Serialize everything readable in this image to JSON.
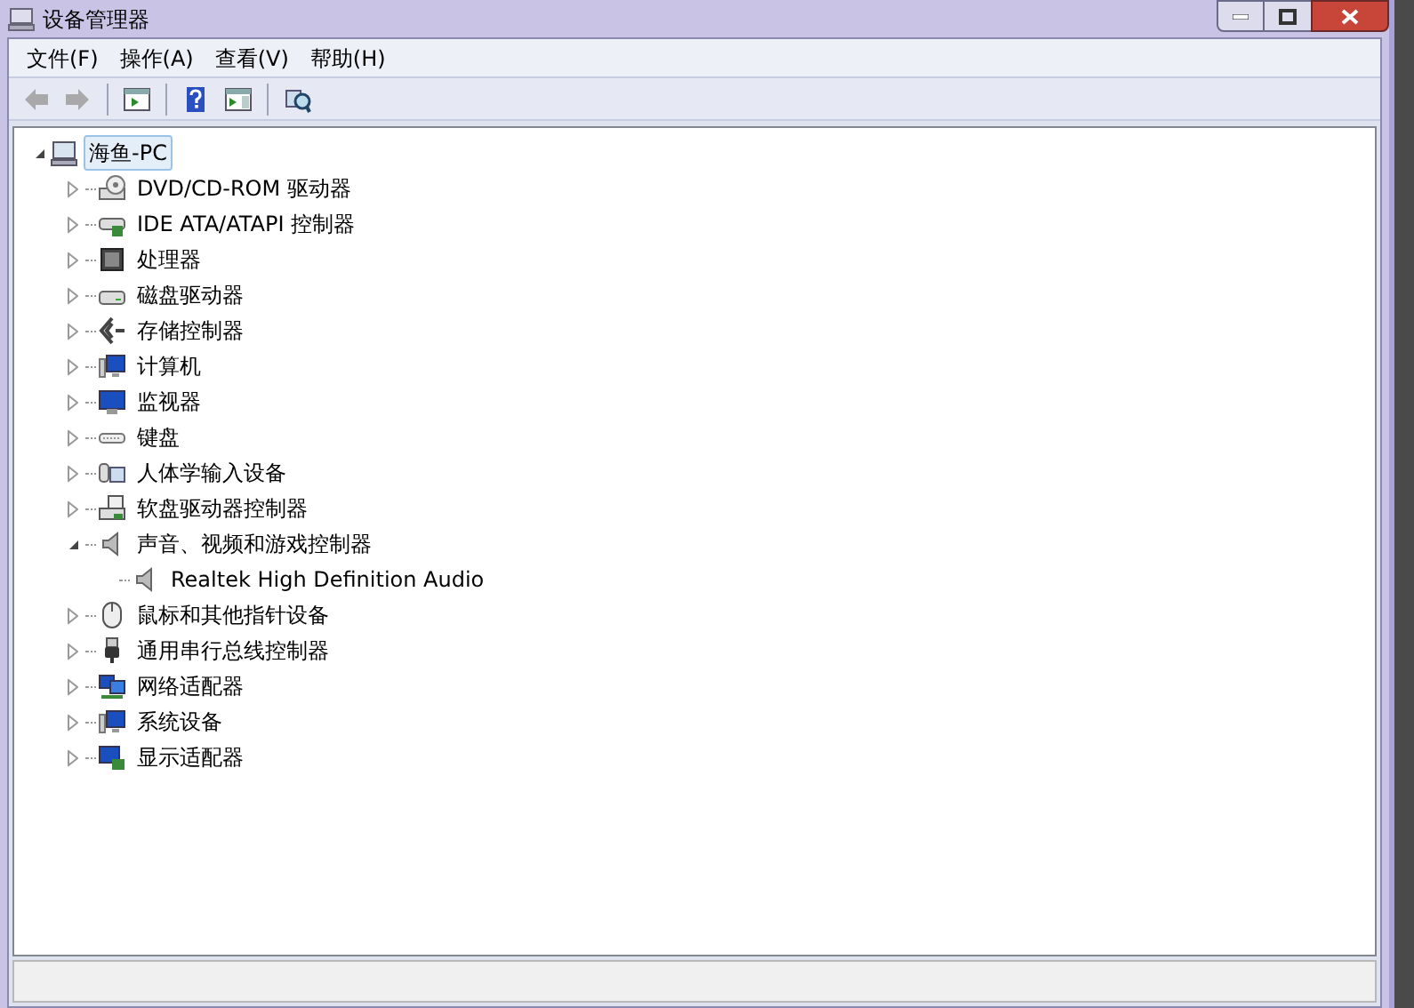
{
  "window": {
    "title": "设备管理器"
  },
  "menu": [
    {
      "label": "文件(F)"
    },
    {
      "label": "操作(A)"
    },
    {
      "label": "查看(V)"
    },
    {
      "label": "帮助(H)"
    }
  ],
  "toolbar": [
    {
      "kind": "back",
      "disabled": true
    },
    {
      "kind": "forward",
      "disabled": true
    },
    {
      "kind": "sep"
    },
    {
      "kind": "console",
      "disabled": false
    },
    {
      "kind": "sep"
    },
    {
      "kind": "help",
      "disabled": false
    },
    {
      "kind": "pane",
      "disabled": false
    },
    {
      "kind": "sep"
    },
    {
      "kind": "scan",
      "disabled": false
    }
  ],
  "tree": {
    "label": "海鱼-PC",
    "expanded": true,
    "selected": true,
    "children": [
      {
        "label": "DVD/CD-ROM 驱动器",
        "expanded": false
      },
      {
        "label": "IDE ATA/ATAPI 控制器",
        "expanded": false
      },
      {
        "label": "处理器",
        "expanded": false
      },
      {
        "label": "磁盘驱动器",
        "expanded": false
      },
      {
        "label": "存储控制器",
        "expanded": false
      },
      {
        "label": "计算机",
        "expanded": false
      },
      {
        "label": "监视器",
        "expanded": false
      },
      {
        "label": "键盘",
        "expanded": false
      },
      {
        "label": "人体学输入设备",
        "expanded": false
      },
      {
        "label": "软盘驱动器控制器",
        "expanded": false
      },
      {
        "label": "声音、视频和游戏控制器",
        "expanded": true,
        "children": [
          {
            "label": "Realtek High Definition Audio"
          }
        ]
      },
      {
        "label": "鼠标和其他指针设备",
        "expanded": false
      },
      {
        "label": "通用串行总线控制器",
        "expanded": false
      },
      {
        "label": "网络适配器",
        "expanded": false
      },
      {
        "label": "系统设备",
        "expanded": false
      },
      {
        "label": "显示适配器",
        "expanded": false
      }
    ]
  }
}
